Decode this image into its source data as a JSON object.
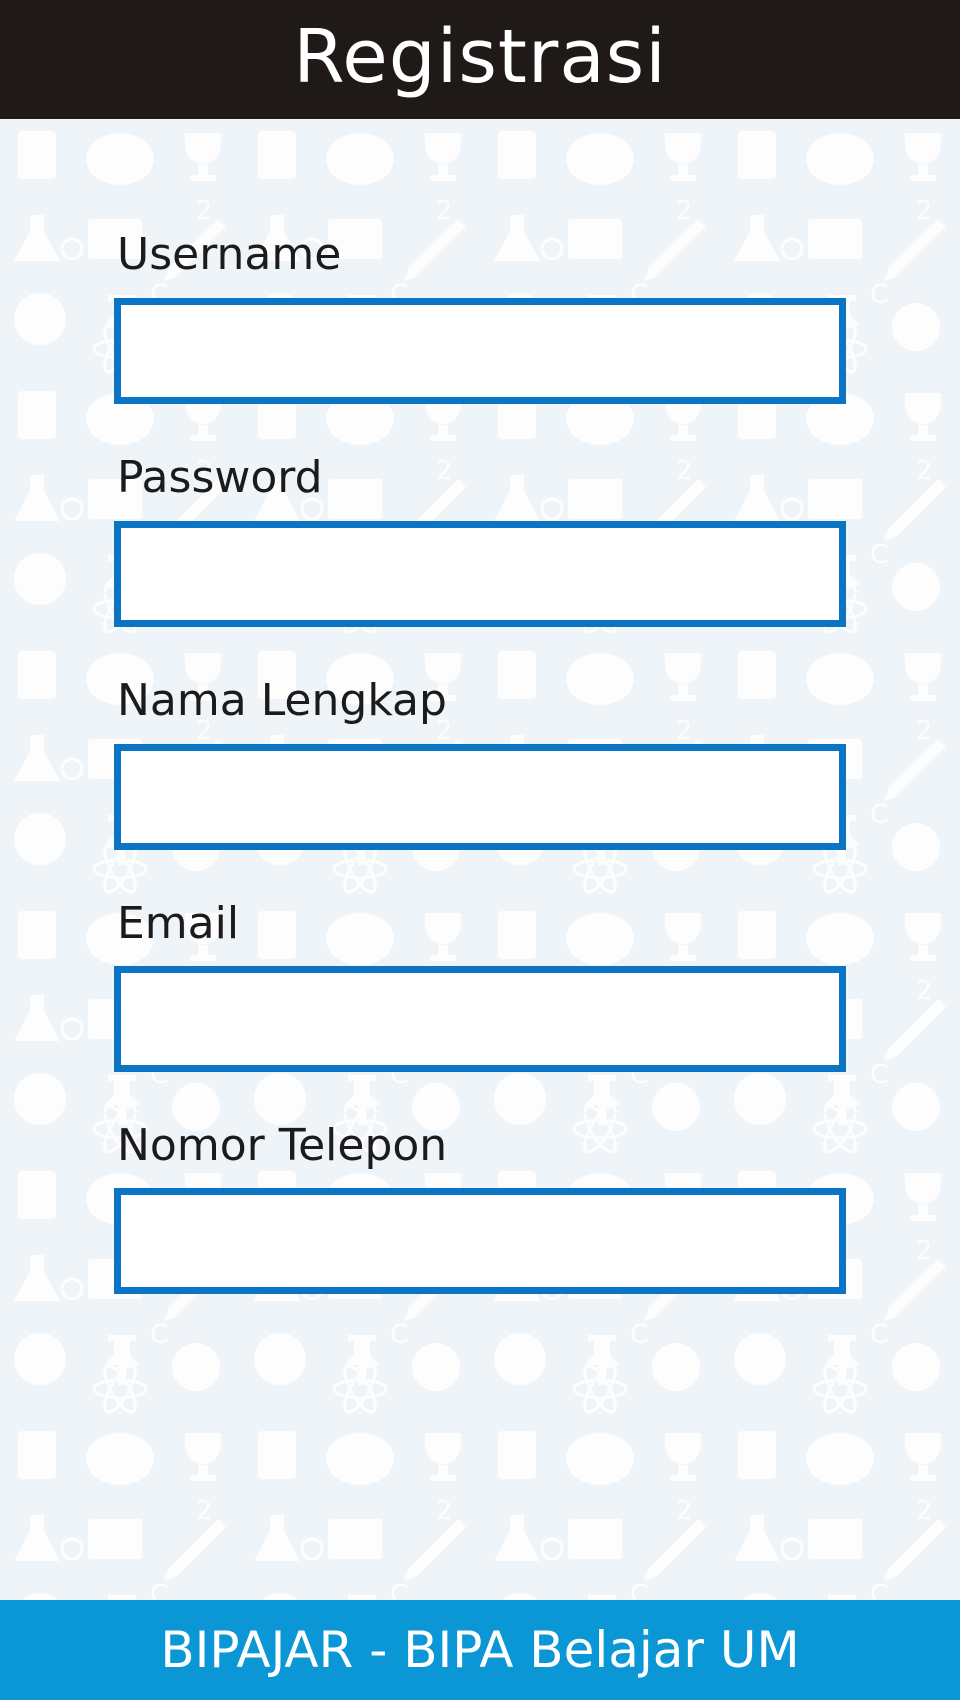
{
  "header": {
    "title": "Registrasi"
  },
  "form": {
    "fields": [
      {
        "label": "Username",
        "value": ""
      },
      {
        "label": "Password",
        "value": ""
      },
      {
        "label": "Nama Lengkap",
        "value": ""
      },
      {
        "label": "Email",
        "value": ""
      },
      {
        "label": "Nomor Telepon",
        "value": ""
      }
    ]
  },
  "footer": {
    "text": "BIPAJAR - BIPA Belajar UM"
  },
  "colors": {
    "header_bg": "#1f1a18",
    "page_bg": "#eff4f8",
    "input_border": "#0b74c4",
    "footer_bg": "#0b96d6"
  }
}
